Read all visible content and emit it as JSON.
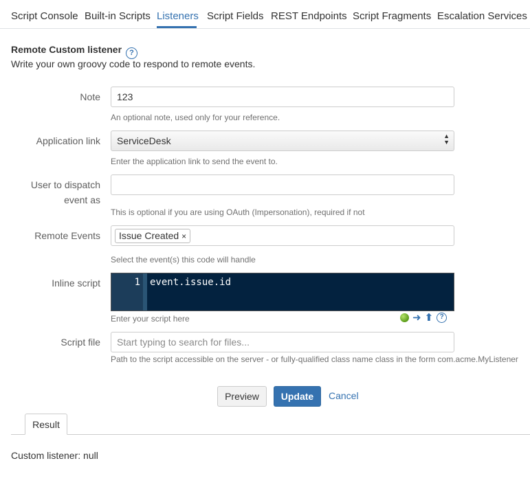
{
  "nav": {
    "tabs": [
      {
        "label": "Script Console"
      },
      {
        "label": "Built-in Scripts"
      },
      {
        "label": "Listeners",
        "active": true
      },
      {
        "label": "Script Fields"
      },
      {
        "label": "REST Endpoints"
      },
      {
        "label": "Script Fragments"
      },
      {
        "label": "Escalation Services"
      }
    ]
  },
  "form": {
    "title": "Remote Custom listener",
    "help_icon": "?",
    "subtitle": "Write your own groovy code to respond to remote events.",
    "note": {
      "label": "Note",
      "value": "123",
      "help": "An optional note, used only for your reference."
    },
    "app_link": {
      "label": "Application link",
      "value": "ServiceDesk",
      "help": "Enter the application link to send the event to."
    },
    "user_dispatch": {
      "label_line1": "User to dispatch",
      "label_line2": "event as",
      "value": "",
      "help": "This is optional if you are using OAuth (Impersonation), required if not"
    },
    "remote_events": {
      "label": "Remote Events",
      "tags": [
        "Issue Created"
      ],
      "remove_symbol": "×",
      "help": "Select the event(s) this code will handle"
    },
    "inline_script": {
      "label": "Inline script",
      "line_number": "1",
      "code": "event.issue.id",
      "help": "Enter your script here",
      "tools": [
        "run-status-icon",
        "arrow-right-icon",
        "arrow-up-icon",
        "help-icon"
      ]
    },
    "script_file": {
      "label": "Script file",
      "placeholder": "Start typing to search for files...",
      "help": "Path to the script accessible on the server - or fully-qualified class name class in the form com.acme.MyListener"
    }
  },
  "buttons": {
    "preview": "Preview",
    "update": "Update",
    "cancel": "Cancel"
  },
  "result": {
    "tab_label": "Result",
    "text": "Custom listener: null"
  },
  "colors": {
    "accent": "#3572b0",
    "editor_bg": "#03223f"
  }
}
